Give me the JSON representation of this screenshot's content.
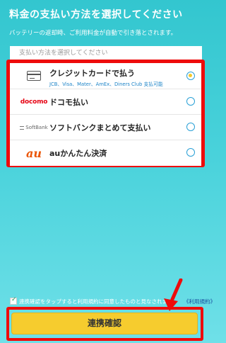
{
  "header": {
    "title": "料金の支払い方法を選択してください",
    "description": "バッテリーの返却時、ご利用料金が自動で引き落とされます。"
  },
  "list": {
    "placeholder": "支払い方法を選択してください",
    "options": [
      {
        "label": "クレジットカードで払う",
        "sub": "JCB、Visa、Mater、AmEx、Diners Club 支払可能",
        "logo_text": "",
        "icon": "credit-card-icon",
        "selected": true
      },
      {
        "label": "ドコモ払い",
        "logo_text": "docomo",
        "icon": "docomo-logo",
        "selected": false
      },
      {
        "label": "ソフトバンクまとめて支払い",
        "logo_text": "SoftBank",
        "icon": "softbank-logo",
        "selected": false
      },
      {
        "label": "auかんたん決済",
        "logo_text": "au",
        "icon": "au-logo",
        "selected": false
      }
    ]
  },
  "agreement": {
    "text": "連携確認をタップすると利用規約に同意したものと見なされます",
    "link": "《利用規約》",
    "checked": true
  },
  "button": {
    "label": "連携確認"
  },
  "colors": {
    "background": "#40ccd5",
    "highlight": "#ee0b0b",
    "button": "#f6cc2e",
    "radio": "#2aa0d6",
    "sub_text": "#1d84c8"
  }
}
